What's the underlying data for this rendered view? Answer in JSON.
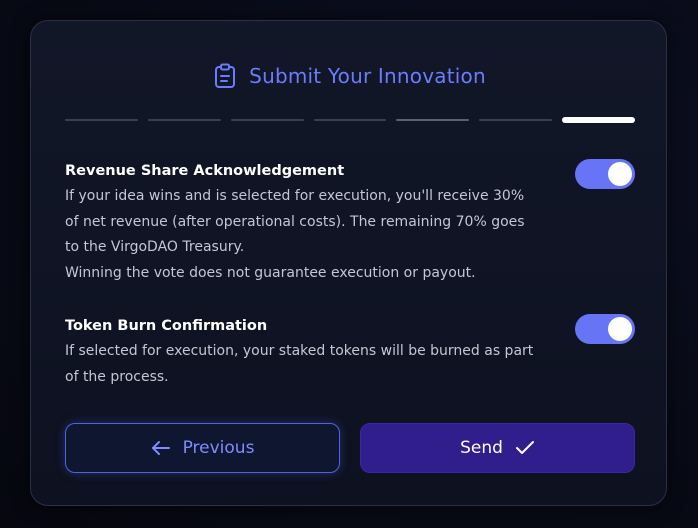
{
  "header": {
    "title": "Submit Your Innovation",
    "icon": "clipboard-icon",
    "accent_color": "#6b7cff"
  },
  "stepper": {
    "total_steps": 7,
    "current_step": 7
  },
  "sections": [
    {
      "title": "Revenue Share Acknowledgement",
      "lines": [
        "If your idea wins and is selected for execution, you'll receive 30%",
        "of net revenue (after operational costs). The remaining 70% goes",
        "to the VirgoDAO Treasury.",
        "Winning the vote does not guarantee execution or payout."
      ],
      "toggle_on": true
    },
    {
      "title": "Token Burn Confirmation",
      "lines": [
        "If selected for execution, your staked tokens will be burned as part",
        "of the process."
      ],
      "toggle_on": true
    }
  ],
  "buttons": {
    "previous_label": "Previous",
    "previous_icon": "arrow-left-icon",
    "send_label": "Send",
    "send_icon": "check-icon"
  },
  "colors": {
    "toggle_on": "#6674f5",
    "send_button": "#2f1e8c",
    "previous_border": "#4f61e8"
  }
}
